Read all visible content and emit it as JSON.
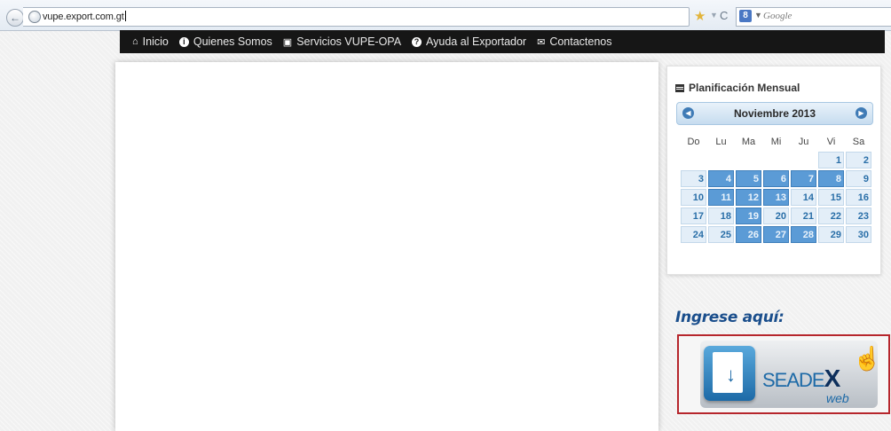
{
  "browser": {
    "url": "vupe.export.com.gt",
    "search_placeholder": "Google",
    "search_engine_letter": "8"
  },
  "nav": {
    "items": [
      {
        "label": "Inicio",
        "icon": "home-icon"
      },
      {
        "label": "Quienes Somos",
        "icon": "info-icon"
      },
      {
        "label": "Servicios VUPE-OPA",
        "icon": "briefcase-icon"
      },
      {
        "label": "Ayuda al Exportador",
        "icon": "help-icon"
      },
      {
        "label": "Contactenos",
        "icon": "envelope-icon"
      }
    ]
  },
  "calendar": {
    "title": "Planificación Mensual",
    "month": "Noviembre 2013",
    "weekdays": [
      "Do",
      "Lu",
      "Ma",
      "Mi",
      "Ju",
      "Vi",
      "Sa"
    ],
    "weeks": [
      [
        "",
        "",
        "",
        "",
        "",
        "1",
        "2"
      ],
      [
        "3",
        "4",
        "5",
        "6",
        "7",
        "8",
        "9"
      ],
      [
        "10",
        "11",
        "12",
        "13",
        "14",
        "15",
        "16"
      ],
      [
        "17",
        "18",
        "19",
        "20",
        "21",
        "22",
        "23"
      ],
      [
        "24",
        "25",
        "26",
        "27",
        "28",
        "29",
        "30"
      ]
    ],
    "highlighted_days": [
      "4",
      "5",
      "6",
      "7",
      "8",
      "11",
      "12",
      "13",
      "19",
      "26",
      "27",
      "28"
    ],
    "accent_color": "#5b9bd6"
  },
  "login": {
    "heading": "Ingrese aquí:",
    "brand_prefix": "SEADE",
    "brand_x": "X",
    "brand_suffix": "web"
  }
}
